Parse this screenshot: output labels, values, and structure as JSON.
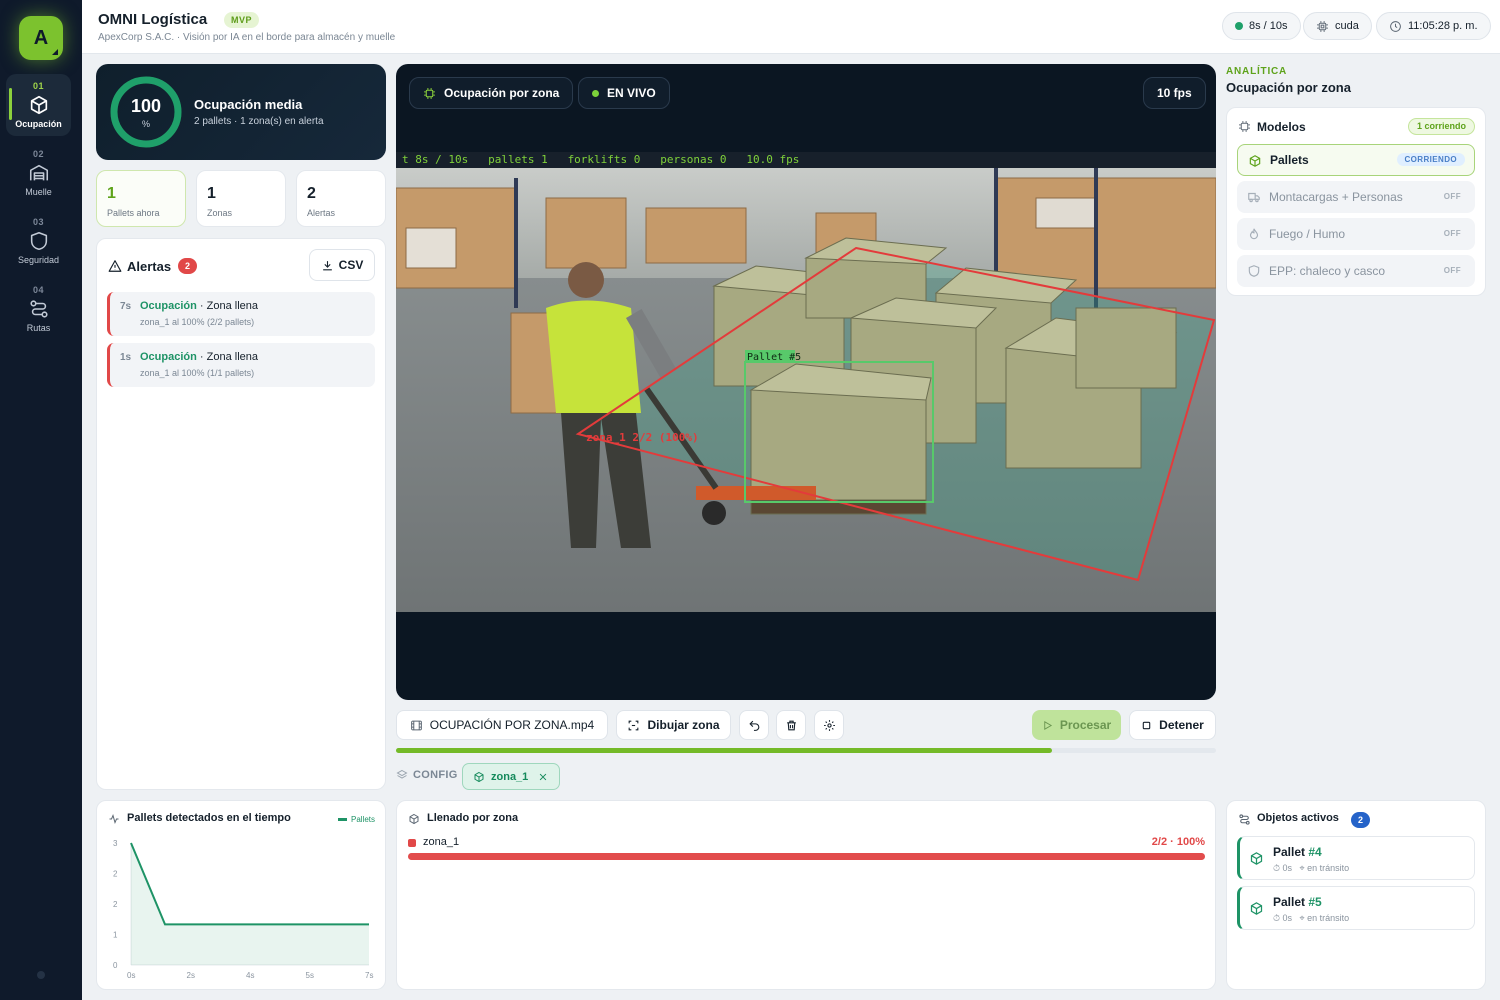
{
  "sidebar": {
    "logo": "A",
    "items": [
      {
        "num": "01",
        "label": "Ocupación",
        "icon": "cube-icon",
        "active": true
      },
      {
        "num": "02",
        "label": "Muelle",
        "icon": "warehouse-icon"
      },
      {
        "num": "03",
        "label": "Seguridad",
        "icon": "shield-icon"
      },
      {
        "num": "04",
        "label": "Rutas",
        "icon": "route-icon"
      }
    ]
  },
  "header": {
    "title": "OMNI Logística",
    "badge": "MVP",
    "subtitle": "ApexCorp S.A.C. · Visión por IA en el borde para almacén y muelle",
    "progress": "8s / 10s",
    "device": "cuda",
    "clock": "11:05:28 p. m."
  },
  "summary": {
    "occupancy_value": "100",
    "occupancy_unit": "%",
    "occupancy_pct": 1.0,
    "title": "Ocupación media",
    "subtitle": "2 pallets · 1 zona(s) en alerta",
    "stats": [
      {
        "value": "1",
        "label": "Pallets ahora"
      },
      {
        "value": "1",
        "label": "Zonas"
      },
      {
        "value": "2",
        "label": "Alertas"
      }
    ]
  },
  "alerts": {
    "title": "Alertas",
    "count": "2",
    "csv_label": "CSV",
    "items": [
      {
        "time": "7s",
        "kind": "Ocupación",
        "title": "· Zona llena",
        "detail": "zona_1 al 100% (2/2 pallets)"
      },
      {
        "time": "1s",
        "kind": "Ocupación",
        "title": "· Zona llena",
        "detail": "zona_1 al 100% (1/1 pallets)"
      }
    ]
  },
  "video": {
    "mode": "Ocupación por zona",
    "live": "EN VIVO",
    "fps": "10 fps",
    "osd": "t 8s / 10s   pallets 1   forklifts 0   personas 0   10.0 fps",
    "zone_label": "zona_1  2/2 (100%)",
    "detection_label": "Pallet #5"
  },
  "controls": {
    "file": "OCUPACIÓN POR ZONA.mp4",
    "draw_zone": "Dibujar zona",
    "process": "Procesar",
    "stop": "Detener",
    "progress_fraction": 0.8,
    "config_label": "CONFIG",
    "zone_chip": "zona_1"
  },
  "analytics": {
    "eyebrow": "ANALÍTICA",
    "title": "Ocupación por zona",
    "models_title": "Modelos",
    "running_badge": "1 corriendo",
    "models": [
      {
        "name": "Pallets",
        "status": "CORRIENDO",
        "icon": "cube-icon"
      },
      {
        "name": "Montacargas + Personas",
        "status": "OFF",
        "icon": "truck-icon"
      },
      {
        "name": "Fuego / Humo",
        "status": "OFF",
        "icon": "flame-icon"
      },
      {
        "name": "EPP: chaleco y casco",
        "status": "OFF",
        "icon": "shield-icon"
      }
    ]
  },
  "timeline": {
    "title": "Pallets detectados en el tiempo",
    "legend": "Pallets"
  },
  "chart_data": {
    "type": "area",
    "x": [
      0,
      1,
      2,
      3,
      4,
      5,
      6,
      7
    ],
    "values": [
      3,
      1,
      1,
      1,
      1,
      1,
      1,
      1
    ],
    "x_ticks": [
      "0s",
      "2s",
      "4s",
      "5s",
      "7s"
    ],
    "y_ticks": [
      "0",
      "1",
      "2",
      "2",
      "3"
    ],
    "ylim": [
      0,
      3
    ],
    "series_name": "Pallets",
    "color": "#1e9366"
  },
  "fill": {
    "title": "Llenado por zona",
    "zones": [
      {
        "name": "zona_1",
        "value": "2/2 · 100%",
        "fraction": 1.0
      }
    ]
  },
  "objects": {
    "title": "Objetos activos",
    "count": "2",
    "items": [
      {
        "name": "Pallet",
        "id": "#4",
        "age": "0s",
        "status": "en tránsito"
      },
      {
        "name": "Pallet",
        "id": "#5",
        "age": "0s",
        "status": "en tránsito"
      }
    ]
  }
}
